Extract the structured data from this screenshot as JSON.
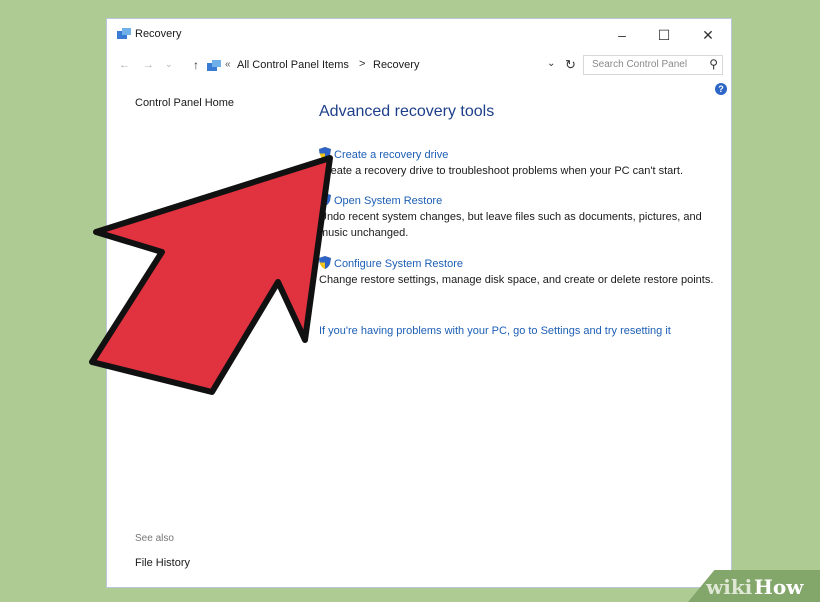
{
  "window": {
    "title": "Recovery",
    "minimize_icon": "minimize-icon",
    "maximize_icon": "maximize-icon",
    "close_icon": "close-icon"
  },
  "address_bar": {
    "back": "←",
    "forward": "→",
    "history_chevron": "⌄",
    "up": "↑",
    "separator0": "«",
    "crumb1": "All Control Panel Items",
    "separator1": ">",
    "crumb2": "Recovery",
    "dropdown": "⌄",
    "refresh": "↻",
    "search_placeholder": "Search Control Panel",
    "search_icon": "search-icon"
  },
  "sidebar": {
    "home": "Control Panel Home",
    "see_also": "See also",
    "file_history": "File History"
  },
  "main": {
    "heading": "Advanced recovery tools",
    "items": [
      {
        "link": "Create a recovery drive",
        "desc": "Create a recovery drive to troubleshoot problems when your PC can't start."
      },
      {
        "link": "Open System Restore",
        "desc": "Undo recent system changes, but leave files such as documents, pictures, and music unchanged."
      },
      {
        "link": "Configure System Restore",
        "desc": "Change restore settings, manage disk space, and create or delete restore points."
      }
    ],
    "reset_link": "If you're having problems with your PC, go to Settings and try resetting it",
    "help_icon": "?"
  },
  "watermark": {
    "wiki": "wiki",
    "how": "How"
  },
  "colors": {
    "background": "#aecb93",
    "arrow_fill": "#e0323f",
    "link": "#1d5fb5",
    "heading": "#1e3f8a"
  }
}
